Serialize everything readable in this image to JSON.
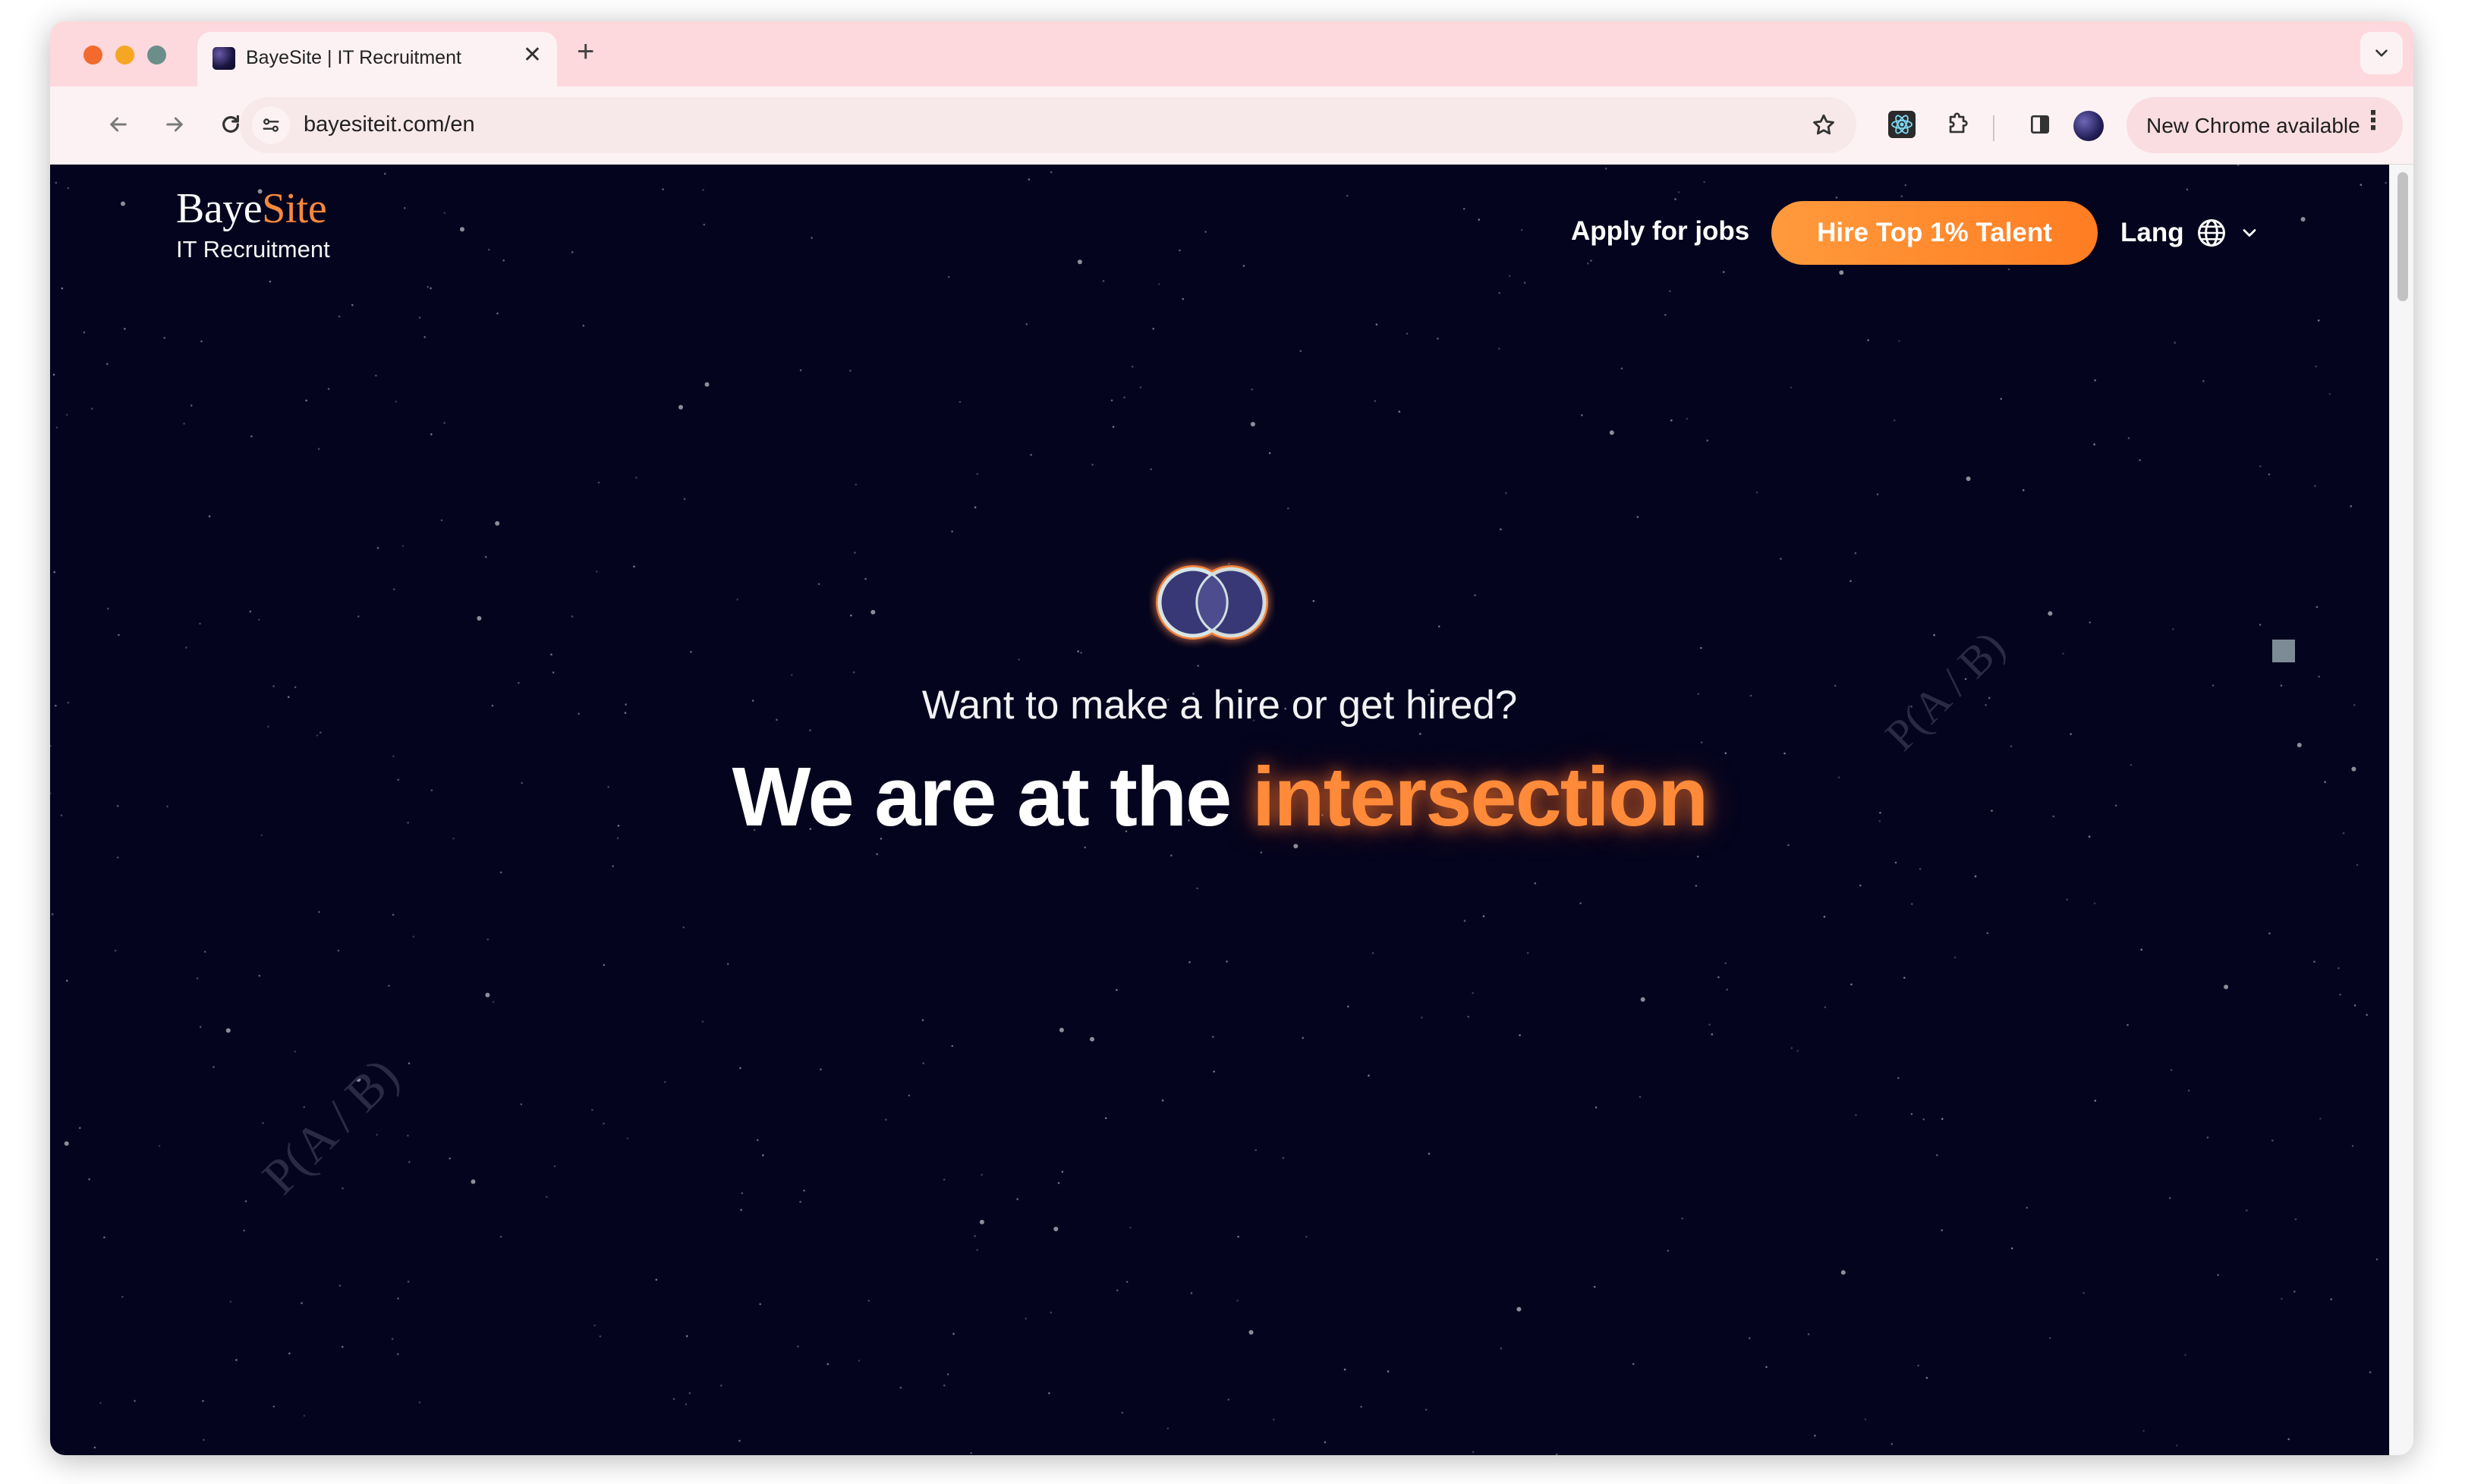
{
  "browser": {
    "tab_title": "BayeSite | IT Recruitment",
    "tab_close": "✕",
    "new_tab": "+",
    "url": "bayesiteit.com/en",
    "update_label": "New Chrome available",
    "update_more": "⋮",
    "traffic_lights": [
      "#f26a2e",
      "#f5a623",
      "#6b8e8a"
    ]
  },
  "site": {
    "logo": {
      "name_main": "Baye",
      "name_accent": "Site",
      "subtitle": "IT Recruitment"
    },
    "nav": {
      "apply_label": "Apply for jobs",
      "hire_label": "Hire Top 1% Talent",
      "lang_label": "Lang"
    },
    "hero": {
      "subtitle": "Want to make a hire or get hired?",
      "title_main": "We are at the ",
      "title_accent": "intersection"
    },
    "watermarks": [
      "P(A / B)",
      "P(A / B)"
    ]
  },
  "colors": {
    "page_bg": "#04041e",
    "accent": "#ff8a3a",
    "tabstrip": "#fdd8dd"
  }
}
